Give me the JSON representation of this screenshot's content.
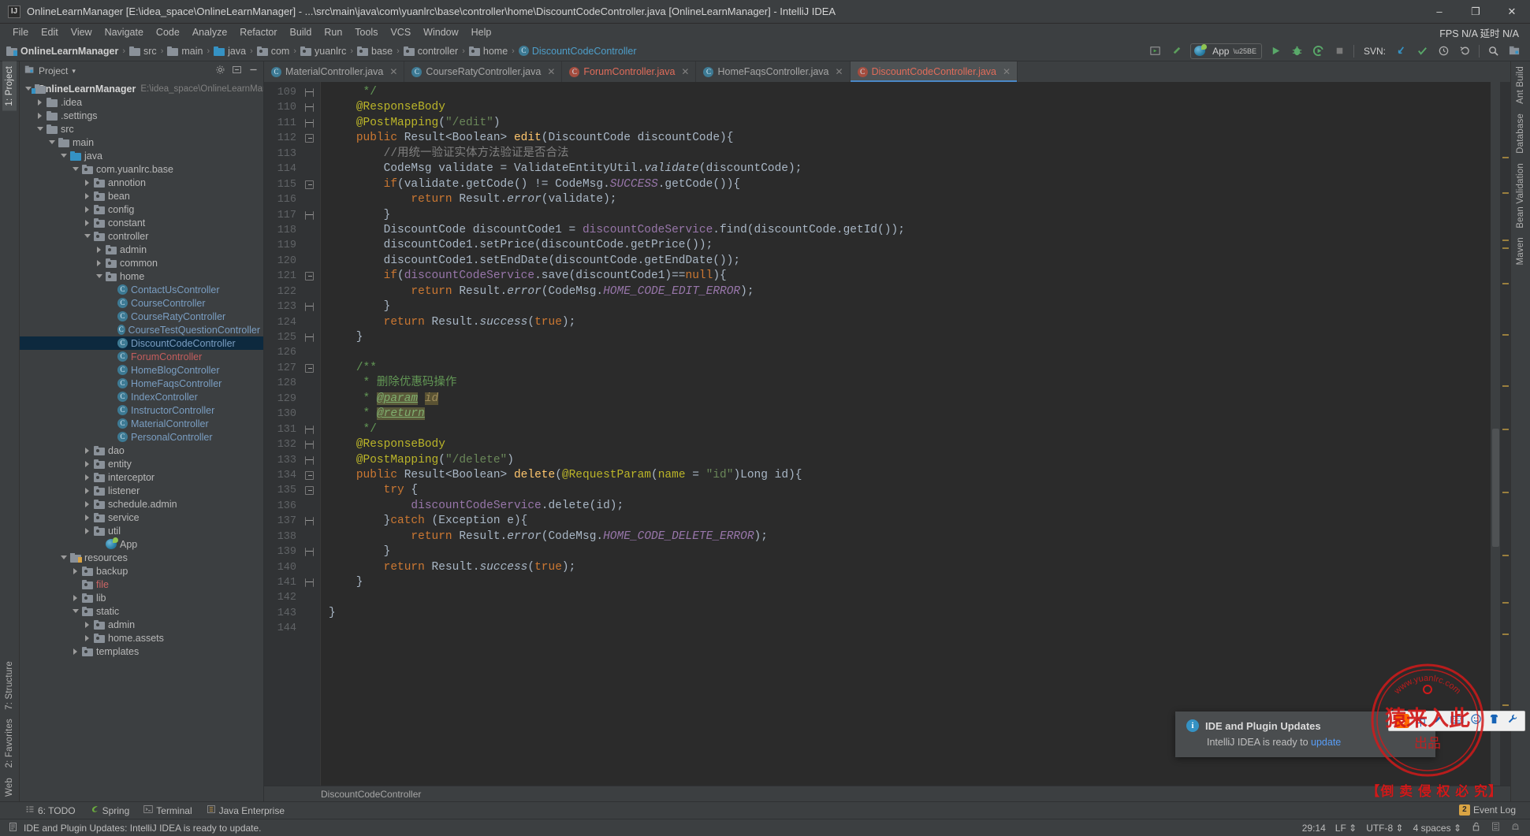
{
  "window": {
    "title": "OnlineLearnManager [E:\\idea_space\\OnlineLearnManager] - ...\\src\\main\\java\\com\\yuanlrc\\base\\controller\\home\\DiscountCodeController.java [OnlineLearnManager] - IntelliJ IDEA",
    "minimize": "–",
    "maximize": "❐",
    "close": "✕"
  },
  "menu": {
    "items": [
      "File",
      "Edit",
      "View",
      "Navigate",
      "Code",
      "Analyze",
      "Refactor",
      "Build",
      "Run",
      "Tools",
      "VCS",
      "Window",
      "Help"
    ],
    "fps": "FPS N/A 延时 N/A"
  },
  "breadcrumb": {
    "separator": "›",
    "items": [
      {
        "label": "OnlineLearnManager",
        "icon": "module-icon",
        "kind": "module"
      },
      {
        "label": "src",
        "icon": "folder-icon",
        "kind": "folder"
      },
      {
        "label": "main",
        "icon": "folder-icon",
        "kind": "folder"
      },
      {
        "label": "java",
        "icon": "source-folder-icon",
        "kind": "source"
      },
      {
        "label": "com",
        "icon": "package-icon",
        "kind": "package"
      },
      {
        "label": "yuanlrc",
        "icon": "package-icon",
        "kind": "package"
      },
      {
        "label": "base",
        "icon": "package-icon",
        "kind": "package"
      },
      {
        "label": "controller",
        "icon": "package-icon",
        "kind": "package"
      },
      {
        "label": "home",
        "icon": "package-icon",
        "kind": "package"
      },
      {
        "label": "DiscountCodeController",
        "icon": "class-icon",
        "kind": "class"
      }
    ]
  },
  "toolbar": {
    "run_config": "App",
    "svn_label": "SVN:",
    "icons": [
      "select-in-icon",
      "pointer-icon",
      "run-icon",
      "debug-icon",
      "run-coverage-icon",
      "stop-icon",
      "svn-update-icon",
      "svn-commit-icon",
      "svn-history-icon",
      "svn-revert-icon",
      "search-everywhere-icon",
      "project-structure-icon"
    ]
  },
  "project_panel": {
    "title": "Project",
    "dropdown": "▾",
    "actions": [
      "collapse-icon",
      "settings-icon",
      "hide-icon"
    ],
    "tree": [
      {
        "depth": 0,
        "arrow": "down",
        "icon": "module-icon",
        "label": "OnlineLearnManager",
        "bold": true,
        "path": "E:\\idea_space\\OnlineLearnManager"
      },
      {
        "depth": 1,
        "arrow": "right",
        "icon": "folder-icon",
        "label": ".idea"
      },
      {
        "depth": 1,
        "arrow": "right",
        "icon": "folder-icon",
        "label": ".settings"
      },
      {
        "depth": 1,
        "arrow": "down",
        "icon": "folder-icon",
        "label": "src"
      },
      {
        "depth": 2,
        "arrow": "down",
        "icon": "folder-icon",
        "label": "main"
      },
      {
        "depth": 3,
        "arrow": "down",
        "icon": "source-folder-icon",
        "label": "java"
      },
      {
        "depth": 4,
        "arrow": "down",
        "icon": "package-icon",
        "label": "com.yuanlrc.base"
      },
      {
        "depth": 5,
        "arrow": "right",
        "icon": "package-icon",
        "label": "annotion"
      },
      {
        "depth": 5,
        "arrow": "right",
        "icon": "package-icon",
        "label": "bean"
      },
      {
        "depth": 5,
        "arrow": "right",
        "icon": "package-icon",
        "label": "config"
      },
      {
        "depth": 5,
        "arrow": "right",
        "icon": "package-icon",
        "label": "constant"
      },
      {
        "depth": 5,
        "arrow": "down",
        "icon": "package-icon",
        "label": "controller"
      },
      {
        "depth": 6,
        "arrow": "right",
        "icon": "package-icon",
        "label": "admin"
      },
      {
        "depth": 6,
        "arrow": "right",
        "icon": "package-icon",
        "label": "common"
      },
      {
        "depth": 6,
        "arrow": "down",
        "icon": "package-icon",
        "label": "home"
      },
      {
        "depth": 7,
        "arrow": "none",
        "icon": "class-icon",
        "label": "ContactUsController",
        "color": "blue"
      },
      {
        "depth": 7,
        "arrow": "none",
        "icon": "class-icon",
        "label": "CourseController",
        "color": "blue"
      },
      {
        "depth": 7,
        "arrow": "none",
        "icon": "class-icon",
        "label": "CourseRatyController",
        "color": "blue"
      },
      {
        "depth": 7,
        "arrow": "none",
        "icon": "class-icon",
        "label": "CourseTestQuestionController",
        "color": "blue"
      },
      {
        "depth": 7,
        "arrow": "none",
        "icon": "class-icon",
        "label": "DiscountCodeController",
        "color": "blue",
        "selected": true
      },
      {
        "depth": 7,
        "arrow": "none",
        "icon": "class-icon",
        "label": "ForumController",
        "color": "red"
      },
      {
        "depth": 7,
        "arrow": "none",
        "icon": "class-icon",
        "label": "HomeBlogController",
        "color": "blue"
      },
      {
        "depth": 7,
        "arrow": "none",
        "icon": "class-icon",
        "label": "HomeFaqsController",
        "color": "blue"
      },
      {
        "depth": 7,
        "arrow": "none",
        "icon": "class-icon",
        "label": "IndexController",
        "color": "blue"
      },
      {
        "depth": 7,
        "arrow": "none",
        "icon": "class-icon",
        "label": "InstructorController",
        "color": "blue"
      },
      {
        "depth": 7,
        "arrow": "none",
        "icon": "class-icon",
        "label": "MaterialController",
        "color": "blue"
      },
      {
        "depth": 7,
        "arrow": "none",
        "icon": "class-icon",
        "label": "PersonalController",
        "color": "blue"
      },
      {
        "depth": 5,
        "arrow": "right",
        "icon": "package-icon",
        "label": "dao"
      },
      {
        "depth": 5,
        "arrow": "right",
        "icon": "package-icon",
        "label": "entity"
      },
      {
        "depth": 5,
        "arrow": "right",
        "icon": "package-icon",
        "label": "interceptor"
      },
      {
        "depth": 5,
        "arrow": "right",
        "icon": "package-icon",
        "label": "listener"
      },
      {
        "depth": 5,
        "arrow": "right",
        "icon": "package-icon",
        "label": "schedule.admin"
      },
      {
        "depth": 5,
        "arrow": "right",
        "icon": "package-icon",
        "label": "service"
      },
      {
        "depth": 5,
        "arrow": "right",
        "icon": "package-icon",
        "label": "util"
      },
      {
        "depth": 6,
        "arrow": "none",
        "icon": "app-icon",
        "label": "App"
      },
      {
        "depth": 3,
        "arrow": "down",
        "icon": "resources-folder-icon",
        "label": "resources"
      },
      {
        "depth": 4,
        "arrow": "right",
        "icon": "package-icon",
        "label": "backup"
      },
      {
        "depth": 4,
        "arrow": "none",
        "icon": "package-icon",
        "label": "file",
        "color": "redf"
      },
      {
        "depth": 4,
        "arrow": "right",
        "icon": "package-icon",
        "label": "lib"
      },
      {
        "depth": 4,
        "arrow": "down",
        "icon": "package-icon",
        "label": "static"
      },
      {
        "depth": 5,
        "arrow": "right",
        "icon": "package-icon",
        "label": "admin"
      },
      {
        "depth": 5,
        "arrow": "right",
        "icon": "package-icon",
        "label": "home.assets"
      },
      {
        "depth": 4,
        "arrow": "right",
        "icon": "package-icon",
        "label": "templates"
      }
    ]
  },
  "left_strip": {
    "tabs": [
      "1: Project",
      "7: Structure",
      "2: Favorites",
      "Web"
    ]
  },
  "right_strip": {
    "tabs": [
      "Ant Build",
      "Database",
      "Bean Validation",
      "Maven"
    ]
  },
  "editor_tabs": [
    {
      "label": "MaterialController.java",
      "color": "normal",
      "active": false,
      "close": "✕"
    },
    {
      "label": "CourseRatyController.java",
      "color": "normal",
      "active": false,
      "close": "✕"
    },
    {
      "label": "ForumController.java",
      "color": "red",
      "active": false,
      "close": "✕"
    },
    {
      "label": "HomeFaqsController.java",
      "color": "normal",
      "active": false,
      "close": "✕"
    },
    {
      "label": "DiscountCodeController.java",
      "color": "red",
      "active": true,
      "close": "✕"
    }
  ],
  "editor": {
    "first_line_number": 109,
    "last_line_number": 144,
    "bottom_breadcrumb": "DiscountCodeController",
    "lines": [
      {
        "n": 109,
        "fold": "end",
        "html": "     <span class='jdoc'>*/</span>"
      },
      {
        "n": 110,
        "fold": "end",
        "html": "    <span class='ann'>@ResponseBody</span>"
      },
      {
        "n": 111,
        "fold": "end",
        "html": "    <span class='ann'>@PostMapping</span>(<span class='str'>\"/edit\"</span>)"
      },
      {
        "n": 112,
        "fold": "start",
        "html": "    <span class='kw'>public</span> Result&lt;Boolean&gt; <span class='mth'>edit</span>(DiscountCode discountCode){"
      },
      {
        "n": 113,
        "fold": "",
        "html": "        <span class='cmt'>//用统一验证实体方法验证是否合法</span>"
      },
      {
        "n": 114,
        "fold": "",
        "html": "        CodeMsg validate = ValidateEntityUtil.<span class='mthi'>validate</span>(discountCode);"
      },
      {
        "n": 115,
        "fold": "start",
        "html": "        <span class='kw'>if</span>(validate.getCode() != CodeMsg.<span class='stat'>SUCCESS</span>.getCode()){"
      },
      {
        "n": 116,
        "fold": "",
        "html": "            <span class='kw'>return</span> Result.<span class='mthi'>error</span>(validate);"
      },
      {
        "n": 117,
        "fold": "end",
        "html": "        }"
      },
      {
        "n": 118,
        "fold": "",
        "html": "        DiscountCode discountCode1 = <span class='fld'>discountCodeService</span>.find(discountCode.getId());"
      },
      {
        "n": 119,
        "fold": "",
        "html": "        discountCode1.setPrice(discountCode.getPrice());"
      },
      {
        "n": 120,
        "fold": "",
        "html": "        discountCode1.setEndDate(discountCode.getEndDate());"
      },
      {
        "n": 121,
        "fold": "start",
        "html": "        <span class='kw'>if</span>(<span class='fld'>discountCodeService</span>.save(discountCode1)==<span class='kw'>null</span>){"
      },
      {
        "n": 122,
        "fold": "",
        "html": "            <span class='kw'>return</span> Result.<span class='mthi'>error</span>(CodeMsg.<span class='stat'>HOME_CODE_EDIT_ERROR</span>);"
      },
      {
        "n": 123,
        "fold": "end",
        "html": "        }"
      },
      {
        "n": 124,
        "fold": "",
        "html": "        <span class='kw'>return</span> Result.<span class='mthi'>success</span>(<span class='kw'>true</span>);"
      },
      {
        "n": 125,
        "fold": "end",
        "html": "    }"
      },
      {
        "n": 126,
        "fold": "",
        "html": ""
      },
      {
        "n": 127,
        "fold": "start",
        "html": "    <span class='jdoc'>/**</span>"
      },
      {
        "n": 128,
        "fold": "",
        "html": "     <span class='jdoc'>* 删除优惠码操作</span>"
      },
      {
        "n": 129,
        "fold": "",
        "html": "     <span class='jdoc'>* </span><span class='jdoc-hl2'>@param</span> <span class='jdoc-hl'>id</span>"
      },
      {
        "n": 130,
        "fold": "",
        "html": "     <span class='jdoc'>* </span><span class='jdoc-hl2'>@return</span>"
      },
      {
        "n": 131,
        "fold": "end",
        "html": "     <span class='jdoc'>*/</span>"
      },
      {
        "n": 132,
        "fold": "end",
        "html": "    <span class='ann'>@ResponseBody</span>"
      },
      {
        "n": 133,
        "fold": "end",
        "html": "    <span class='ann'>@PostMapping</span>(<span class='str'>\"/delete\"</span>)"
      },
      {
        "n": 134,
        "fold": "start",
        "html": "    <span class='kw'>public</span> Result&lt;Boolean&gt; <span class='mth'>delete</span>(<span class='ann'>@RequestParam</span>(<span class='ann'>name</span> = <span class='str'>\"id\"</span>)Long id){"
      },
      {
        "n": 135,
        "fold": "start",
        "html": "        <span class='kw'>try</span> {"
      },
      {
        "n": 136,
        "fold": "",
        "html": "            <span class='fld'>discountCodeService</span>.delete(id);"
      },
      {
        "n": 137,
        "fold": "end",
        "html": "        }<span class='kw'>catch</span> (Exception e){"
      },
      {
        "n": 138,
        "fold": "",
        "html": "            <span class='kw'>return</span> Result.<span class='mthi'>error</span>(CodeMsg.<span class='stat'>HOME_CODE_DELETE_ERROR</span>);"
      },
      {
        "n": 139,
        "fold": "end",
        "html": "        }"
      },
      {
        "n": 140,
        "fold": "",
        "html": "        <span class='kw'>return</span> Result.<span class='mthi'>success</span>(<span class='kw'>true</span>);"
      },
      {
        "n": 141,
        "fold": "end",
        "html": "    }"
      },
      {
        "n": 142,
        "fold": "",
        "html": ""
      },
      {
        "n": 143,
        "fold": "",
        "html": "}"
      },
      {
        "n": 144,
        "fold": "",
        "html": ""
      }
    ]
  },
  "bottom_tabs": [
    {
      "label": "6: TODO",
      "icon": "todo-icon"
    },
    {
      "label": "Spring",
      "icon": "spring-icon"
    },
    {
      "label": "Terminal",
      "icon": "terminal-icon"
    },
    {
      "label": "Java Enterprise",
      "icon": "java-enterprise-icon"
    }
  ],
  "statusbar": {
    "message": "IDE and Plugin Updates: IntelliJ IDEA is ready to update.",
    "caret": "29:14",
    "line_sep": "LF ⇕",
    "encoding": "UTF-8 ⇕",
    "indent": "4 spaces ⇕",
    "lock_icon": "unlock-icon",
    "readonly_icon": "memory-icon",
    "hector_icon": "inspection-icon",
    "event_log": "Event Log",
    "event_badge": "2"
  },
  "notification": {
    "title": "IDE and Plugin Updates",
    "body_prefix": "IntelliJ IDEA is ready to ",
    "body_link": "update"
  },
  "ime": {
    "engine": "S",
    "mode": "中",
    "icons": [
      "pen-icon",
      "keyboard-icon",
      "emoji-icon",
      "skin-icon",
      "tools-icon"
    ]
  },
  "watermark": {
    "url": "www.yuanlrc.com",
    "seal_text": "猿来入此",
    "seal_sub": "出品",
    "warning": "【倒 卖 侵 权 必 究】",
    "color": "#d11a1a"
  }
}
